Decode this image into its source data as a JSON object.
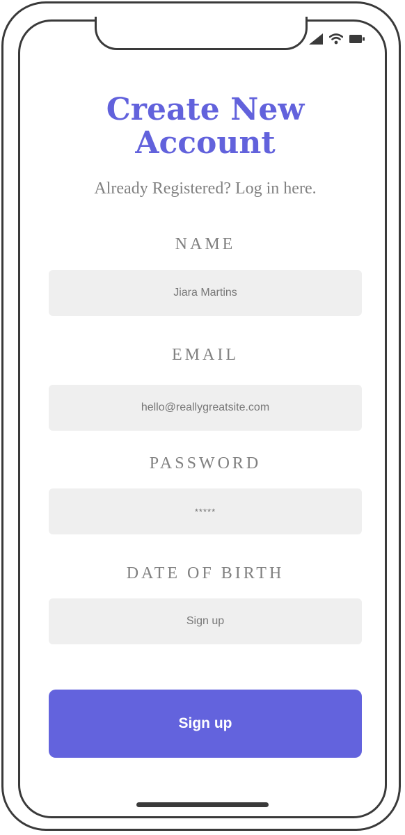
{
  "form": {
    "title_line1": "Create New",
    "title_line2": "Account",
    "login_link": "Already Registered? Log in here.",
    "fields": [
      {
        "label": "NAME",
        "value": "Jiara Martins"
      },
      {
        "label": "EMAIL",
        "value": "hello@reallygreatsite.com"
      },
      {
        "label": "PASSWORD",
        "value": "*****"
      },
      {
        "label": "DATE OF BIRTH",
        "value": "Sign up"
      }
    ],
    "submit_label": "Sign up"
  },
  "colors": {
    "accent": "#6363dd",
    "title": "#6262dc",
    "input_bg": "#efefef",
    "muted_text": "#808080",
    "frame": "#3a3a3a"
  },
  "status_icons": [
    "cellular-signal-icon",
    "wifi-icon",
    "battery-icon"
  ]
}
